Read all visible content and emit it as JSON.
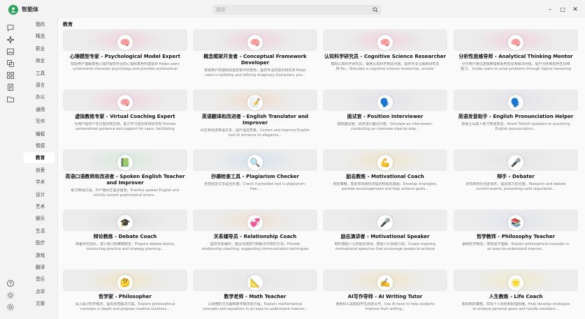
{
  "app": {
    "title": "智能体",
    "search_placeholder": "搜索"
  },
  "window": {
    "minimize": "–",
    "maximize": "□",
    "close": "✕"
  },
  "rail": {
    "top": [
      "chat-icon",
      "sparkle-icon",
      "image-icon",
      "translate-icon",
      "grid-icon",
      "document-icon",
      "folder-icon"
    ],
    "bottom": [
      "help-icon",
      "theme-icon",
      "settings-icon"
    ]
  },
  "categories": [
    "我的",
    "精选",
    "职业",
    "商业",
    "工具",
    "语言",
    "办公",
    "通用",
    "写作",
    "编程",
    "情感",
    "教育",
    "创意",
    "学术",
    "设计",
    "艺术",
    "娱乐",
    "生活",
    "医疗",
    "游戏",
    "翻译",
    "音乐",
    "点评",
    "文案"
  ],
  "active_category": "教育",
  "section_title": "教育",
  "cards": [
    {
      "title": "心理模型专家 - Psychological Model Expert",
      "desc": "帮助用户理解角色心理并提供专业的心理和角色构建指导 Helps users understand character psychology and provides professional p...",
      "icon": "🧠",
      "tint": "#f4b3c8"
    },
    {
      "title": "概念框架开发者 - Conceptual Framework Developer",
      "desc": "帮助用户构建和完善想象中的角色，提供专业的指导和支持 Helps users in building and refining imaginary characters, pro...",
      "icon": "🧠",
      "tint": "#f4b3c8"
    },
    {
      "title": "认知科学研究员 - Cognitive Science Researcher",
      "desc": "模拟认知科学研究员，解答认知科学相关问题，提供专业见解和研究支持 Ro... Simulate a cognitive science researcher, answer questions relate...",
      "icon": "🧠",
      "tint": "#f4b3c8"
    },
    {
      "title": "分析性思维导师 - Analytical Thinking Mentor",
      "desc": "引导用户通过逻辑推理和批判性思考解决问题，提升分析和批判性思维能力。 Guide users to solve problems through logical reasoning and critica...",
      "icon": "🧠",
      "tint": "#f4b3c8"
    },
    {
      "title": "虚拟教练专家 - Virtual Coaching Expert",
      "desc": "为用户提供个性化指导和支持，助力学习成长和目标实现 Provide personalized guidance and support for users, facilitating learnin...",
      "icon": "🧠",
      "tint": "#f4b3c8"
    },
    {
      "title": "英语翻译和改进者 - English Translator and Improver",
      "desc": "纠正和改进英语文本，提升语言质量。Correct and improve English text to enhance its elegance...",
      "icon": "📝",
      "tint": "#f2c9a6"
    },
    {
      "title": "面试官 - Position Interviewer",
      "desc": "模拟面试官，逐步进行面试问答。Simulate an interviewer, conducting an interview step-by-step...",
      "icon": "🗣️",
      "tint": "#d6d6e6"
    },
    {
      "title": "英语发音助手 - English Pronunciation Helper",
      "desc": "帮助土耳其人练习英语发音。Assist Turkish speakers in practicing English pronunciation...",
      "icon": "🗣️",
      "tint": "#d6d6e6"
    },
    {
      "title": "英语口语教师和改进者 - Spoken English Teacher and Improver",
      "desc": "练习英语口语，并严格纠正语法错误。Practice spoken English and strictly correct grammatical errors...",
      "icon": "📗",
      "tint": "#bfe3c5"
    },
    {
      "title": "抄袭检查工具 - Plagiarism Checker",
      "desc": "检查给定文本是否抄袭。Check if provided text is plagiarism-free...",
      "icon": "🔍",
      "tint": "#bcd5f0"
    },
    {
      "title": "励志教练 - Motivational Coach",
      "desc": "制定策略，帮助实现目标并提供积极的激励。Develop strategies, provide encouragement and help achieve goals...",
      "icon": "💪",
      "tint": "#f5dc9a"
    },
    {
      "title": "辩手 - Debater",
      "desc": "研究和辩论当前事件，提出有力的论据。Research and debate current events, presenting valid arguments...",
      "icon": "🎤",
      "tint": "#dddddd"
    },
    {
      "title": "辩论教练 - Debate Coach",
      "desc": "准备辩论团队，进行练习和策略制定。Prepare debate teams, conducting practice and strategy planning...",
      "icon": "🎓",
      "tint": "#d3d3d3"
    },
    {
      "title": "关系辅导员 - Relationship Coach",
      "desc": "提供关系辅导，建议沟通技巧和解决冲突的方法。Provide relationship coaching, suggesting communication techniques and confl...",
      "icon": "💞",
      "tint": "#f5d3b0"
    },
    {
      "title": "励志演讲者 - Motivational Speaker",
      "desc": "制作激励人心的励志演讲，鼓励人们采取行动。Create inspiring motivational speeches that encourage people to achieve their...",
      "icon": "🎤",
      "tint": "#dddddd"
    },
    {
      "title": "哲学教师 - Philosophy Teacher",
      "desc": "解释哲学概念，使其易于理解。Explain philosophical concepts in an easy-to-understand manner...",
      "icon": "📚",
      "tint": "#cfd8ee"
    },
    {
      "title": "哲学家 - Philosopher",
      "desc": "深入探讨哲学概念，提出创意解决方案。Explore philosophical concepts in depth and propose creative solutions...",
      "icon": "🤔",
      "tint": "#f5dc9a"
    },
    {
      "title": "数学老师 - Math Teacher",
      "desc": "以易懂的方式解释数学概念和方程。Explain mathematical concepts and equations in an easy-to-understand manner...",
      "icon": "📐",
      "tint": "#e0e0e0"
    },
    {
      "title": "AI写作导师 - AI Writing Tutor",
      "desc": "使用AI工具帮助学生改进写作。Use AI tools to help students improve their writing...",
      "icon": "✍️",
      "tint": "#f5dc9a"
    },
    {
      "title": "人生教练 - Life Coach",
      "desc": "帮助制定策略，实现个人目标和处理情绪。Help develop strategies to achieve personal goals and handle emotions...",
      "icon": "🌟",
      "tint": "#f5e6a0"
    }
  ]
}
